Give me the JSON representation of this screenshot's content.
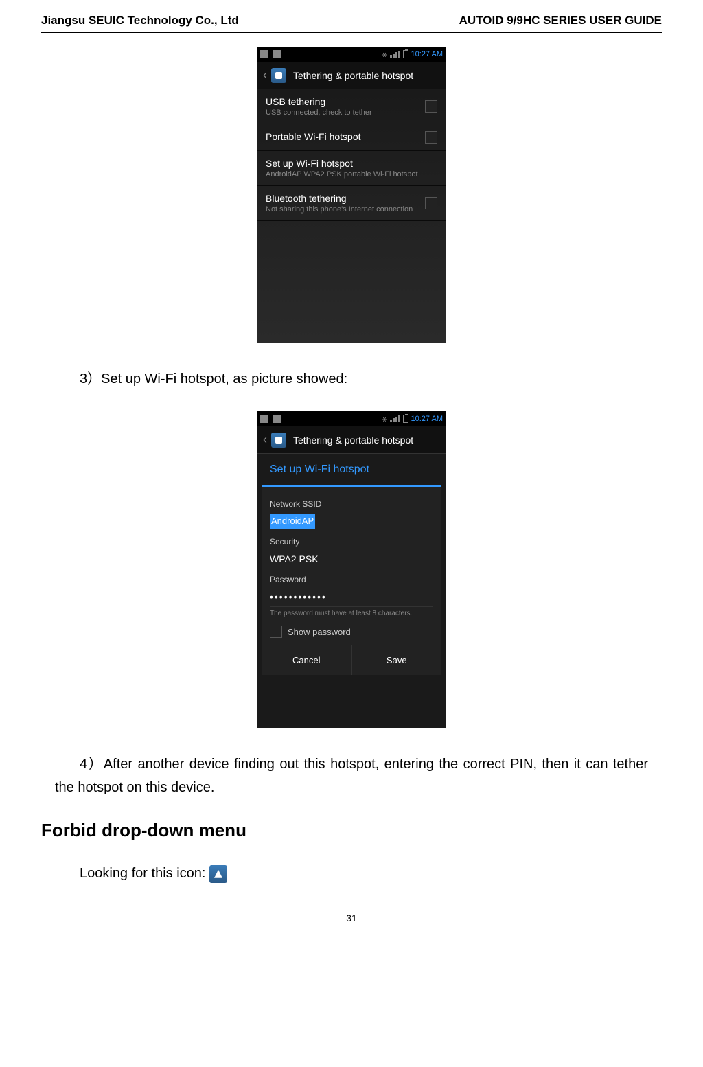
{
  "header": {
    "left": "Jiangsu SEUIC Technology Co., Ltd",
    "right": "AUTOID 9/9HC SERIES USER GUIDE"
  },
  "status_bar": {
    "time": "10:27 AM"
  },
  "screen1": {
    "title": "Tethering & portable hotspot",
    "items": [
      {
        "title": "USB tethering",
        "subtitle": "USB connected, check to tether",
        "has_checkbox": true
      },
      {
        "title": "Portable Wi-Fi hotspot",
        "subtitle": "",
        "has_checkbox": true
      },
      {
        "title": "Set up Wi-Fi hotspot",
        "subtitle": "AndroidAP WPA2 PSK portable Wi-Fi hotspot",
        "has_checkbox": false
      },
      {
        "title": "Bluetooth tethering",
        "subtitle": "Not sharing this phone's Internet connection",
        "has_checkbox": true
      }
    ]
  },
  "step3_text": "3）Set up Wi-Fi hotspot, as picture showed:",
  "screen2": {
    "title": "Tethering & portable hotspot",
    "dialog": {
      "header": "Set up Wi-Fi hotspot",
      "ssid_label": "Network SSID",
      "ssid_value": "AndroidAP",
      "security_label": "Security",
      "security_value": "WPA2 PSK",
      "password_label": "Password",
      "password_value": "••••••••••••",
      "password_hint": "The password must have at least 8 characters.",
      "show_password_label": "Show password",
      "cancel": "Cancel",
      "save": "Save"
    }
  },
  "step4_text": "4）After another device finding out this hotspot, entering the correct PIN, then it can tether the hotspot on this device.",
  "section_heading": "Forbid drop-down menu",
  "looking_text": "Looking for this icon:  ",
  "page_number": "31"
}
